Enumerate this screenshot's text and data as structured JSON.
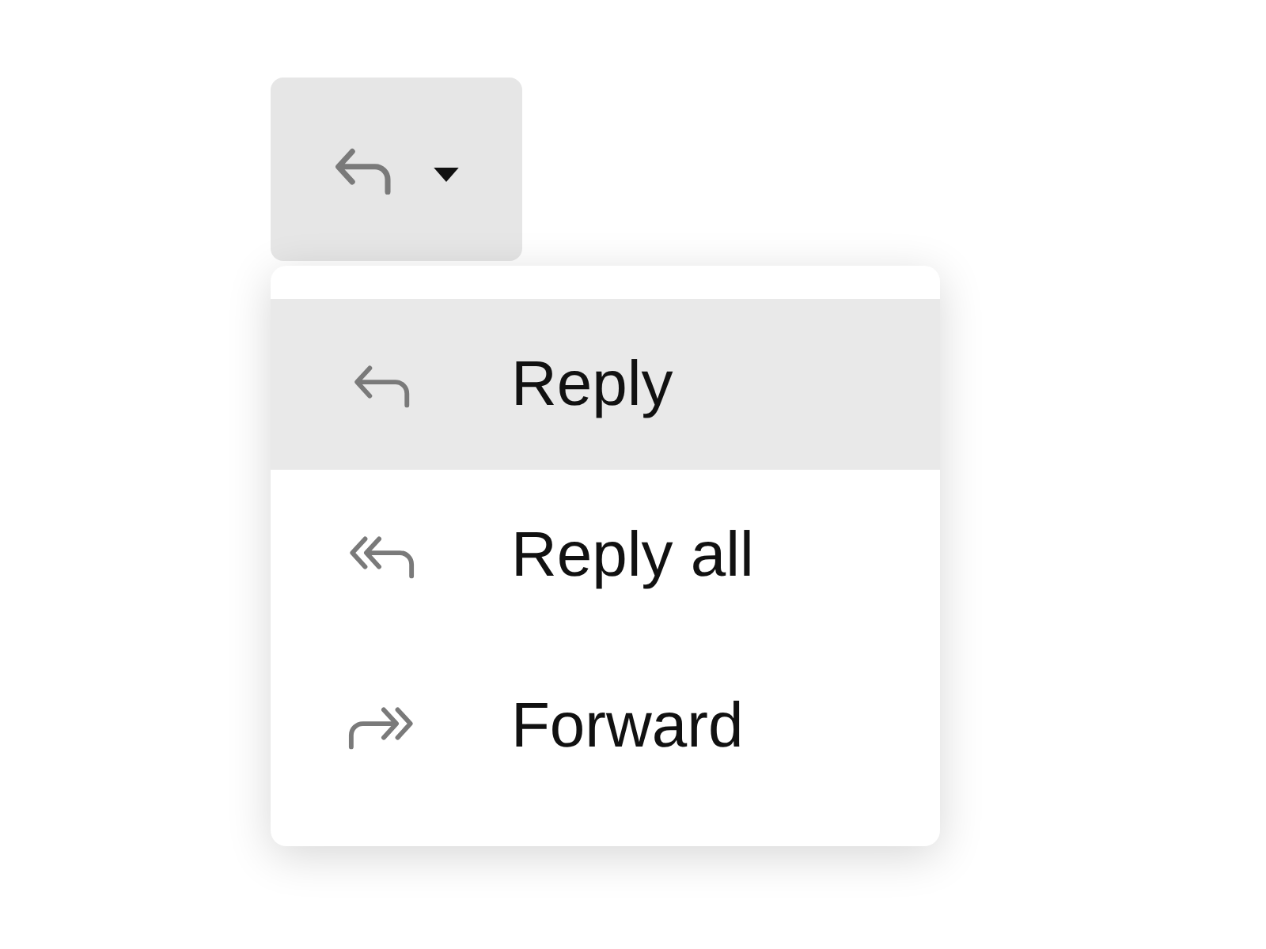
{
  "menu_button": {
    "kind": "reply"
  },
  "menu": {
    "items": [
      {
        "kind": "reply",
        "label": "Reply",
        "selected": true
      },
      {
        "kind": "reply-all",
        "label": "Reply all",
        "selected": false
      },
      {
        "kind": "forward",
        "label": "Forward",
        "selected": false
      }
    ]
  }
}
